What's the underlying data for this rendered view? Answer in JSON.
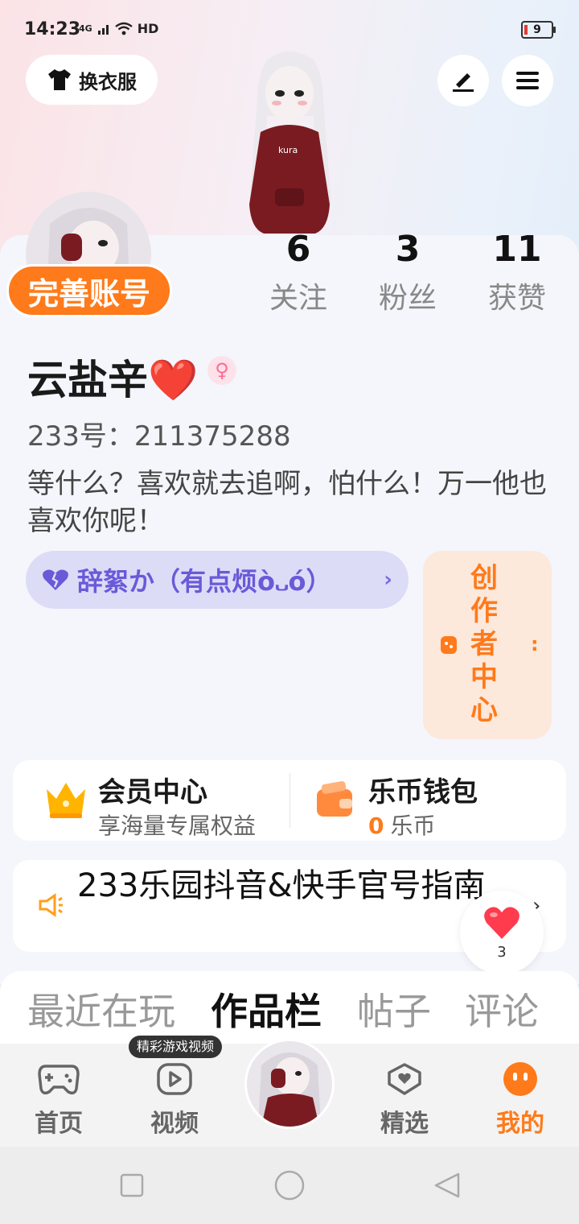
{
  "status_bar": {
    "time": "14:23",
    "network": "4G",
    "hd": "HD",
    "battery": "9"
  },
  "top": {
    "dress_label": "换衣服"
  },
  "profile": {
    "complete_label": "完善账号",
    "stats": [
      {
        "num": "6",
        "label": "关注"
      },
      {
        "num": "3",
        "label": "粉丝"
      },
      {
        "num": "11",
        "label": "获赞"
      }
    ],
    "name": "云盐辛❤️",
    "uid": "233号：211375288",
    "bio": "等什么？喜欢就去追啊，怕什么！万一他也喜欢你呢！",
    "mood": "辞絮か（有点烦ò᎑ó）",
    "creator": "创作者中心"
  },
  "member": {
    "title": "会员中心",
    "subtitle": "享海量专属权益"
  },
  "wallet": {
    "title": "乐币钱包",
    "amount": "0",
    "unit": "乐币"
  },
  "notice": {
    "text": "233乐园抖音&快手官号指南"
  },
  "float_heart": {
    "count": "3"
  },
  "tabs": [
    "最近在玩",
    "作品栏",
    "帖子",
    "评论"
  ],
  "nav": {
    "tooltip": "精彩游戏视频",
    "items": [
      "首页",
      "视频",
      "精选",
      "我的"
    ]
  },
  "colors": {
    "accent": "#ff7a1a",
    "mood": "#6a5ad8"
  }
}
